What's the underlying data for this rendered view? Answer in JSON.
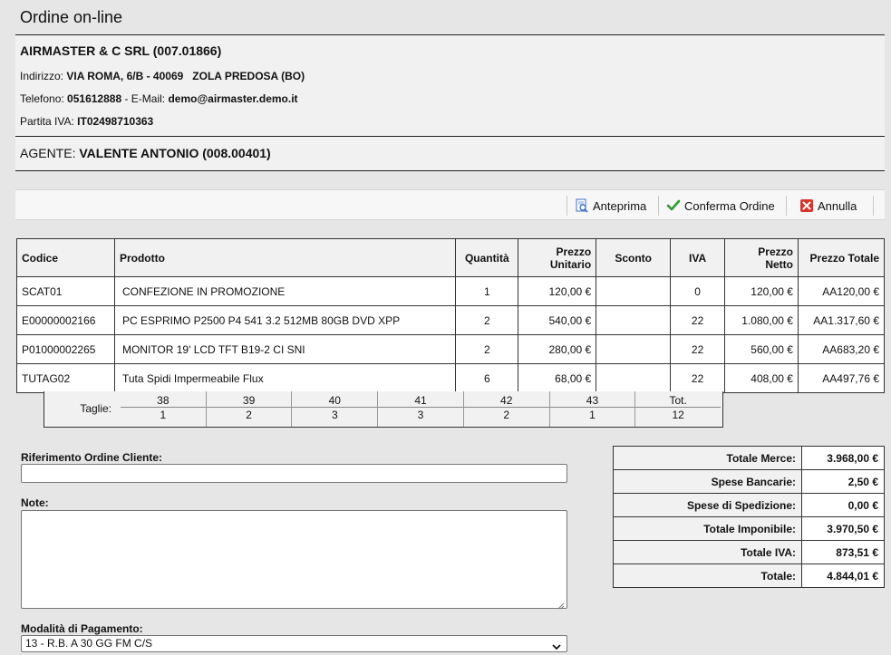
{
  "page": {
    "title": "Ordine on-line"
  },
  "customer": {
    "name": "AIRMASTER & C SRL (007.01866)",
    "address_label": "Indirizzo:",
    "address_value": "VIA ROMA, 6/B - 40069   ZOLA PREDOSA (BO)",
    "phone_label": "Telefono:",
    "phone_value": "051612888",
    "email_label": " - E-Mail:",
    "email_value": "demo@airmaster.demo.it",
    "vat_label": "Partita IVA:",
    "vat_value": "IT02498710363"
  },
  "agent": {
    "label": "AGENTE:",
    "value": "VALENTE ANTONIO (008.00401)"
  },
  "toolbar": {
    "preview_label": "Anteprima",
    "confirm_label": "Conferma Ordine",
    "cancel_label": "Annulla"
  },
  "items_table": {
    "headers": {
      "code": "Codice",
      "product": "Prodotto",
      "quantity": "Quantità",
      "unit_price": "Prezzo Unitario",
      "discount": "Sconto",
      "vat": "IVA",
      "net_price": "Prezzo Netto",
      "total_price": "Prezzo Totale"
    },
    "rows": [
      {
        "code": "SCAT01",
        "product": "CONFEZIONE IN PROMOZIONE",
        "quantity": "1",
        "unit_price": "120,00 €",
        "discount": "",
        "vat": "0",
        "net_price": "120,00 €",
        "total_price": "AA120,00 €"
      },
      {
        "code": "E00000002166",
        "product": "PC ESPRIMO P2500 P4 541 3.2 512MB 80GB DVD XPP",
        "quantity": "2",
        "unit_price": "540,00 €",
        "discount": "",
        "vat": "22",
        "net_price": "1.080,00 €",
        "total_price": "AA1.317,60 €"
      },
      {
        "code": "P01000002265",
        "product": "MONITOR 19' LCD TFT B19-2 CI SNI",
        "quantity": "2",
        "unit_price": "280,00 €",
        "discount": "",
        "vat": "22",
        "net_price": "560,00 €",
        "total_price": "AA683,20 €"
      },
      {
        "code": "TUTAG02",
        "product": "Tuta Spidi Impermeabile Flux",
        "quantity": "6",
        "unit_price": "68,00 €",
        "discount": "",
        "vat": "22",
        "net_price": "408,00 €",
        "total_price": "AA497,76 €"
      }
    ]
  },
  "sizes": {
    "label": "Taglie:",
    "columns": [
      {
        "size": "38",
        "qty": "1"
      },
      {
        "size": "39",
        "qty": "2"
      },
      {
        "size": "40",
        "qty": "3"
      },
      {
        "size": "41",
        "qty": "3"
      },
      {
        "size": "42",
        "qty": "2"
      },
      {
        "size": "43",
        "qty": "1"
      },
      {
        "size": "Tot.",
        "qty": "12"
      }
    ]
  },
  "form": {
    "reference_label": "Riferimento Ordine Cliente:",
    "reference_value": "",
    "notes_label": "Note:",
    "notes_value": "",
    "payment_label": "Modalità di Pagamento:",
    "payment_value": "13 - R.B. A 30 GG FM C/S"
  },
  "totals": [
    {
      "label": "Totale Merce:",
      "value": "3.968,00 €"
    },
    {
      "label": "Spese Bancarie:",
      "value": "2,50 €"
    },
    {
      "label": "Spese di Spedizione:",
      "value": "0,00 €"
    },
    {
      "label": "Totale Imponibile:",
      "value": "3.970,50 €"
    },
    {
      "label": "Totale IVA:",
      "value": "873,51 €"
    },
    {
      "label": "Totale:",
      "value": "4.844,01 €"
    }
  ],
  "colors": {
    "confirm_check": "#2e9a2e",
    "cancel_red": "#d9342b",
    "preview_blue": "#3b6fc4"
  }
}
